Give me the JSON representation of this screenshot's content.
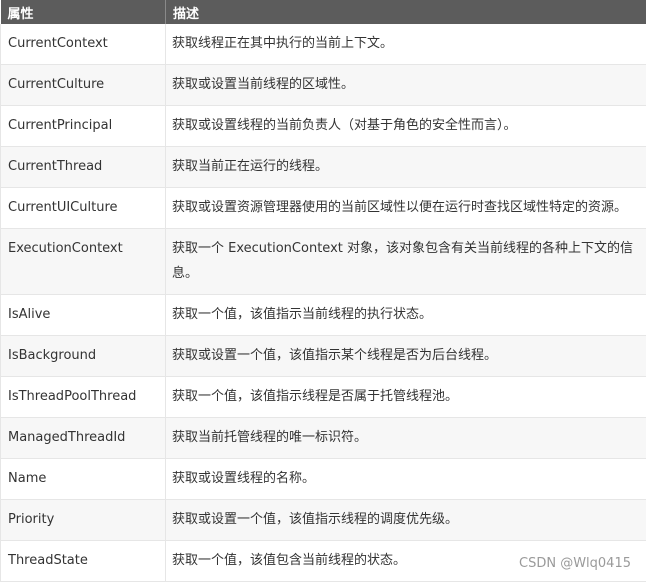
{
  "table": {
    "headers": [
      "属性",
      "描述"
    ],
    "rows": [
      {
        "name": "CurrentContext",
        "desc": "获取线程正在其中执行的当前上下文。"
      },
      {
        "name": "CurrentCulture",
        "desc": "获取或设置当前线程的区域性。"
      },
      {
        "name": "CurrentPrincipal",
        "desc": "获取或设置线程的当前负责人（对基于角色的安全性而言）。"
      },
      {
        "name": "CurrentThread",
        "desc": "获取当前正在运行的线程。"
      },
      {
        "name": "CurrentUICulture",
        "desc": "获取或设置资源管理器使用的当前区域性以便在运行时查找区域性特定的资源。"
      },
      {
        "name": "ExecutionContext",
        "desc": "获取一个 ExecutionContext 对象，该对象包含有关当前线程的各种上下文的信息。"
      },
      {
        "name": "IsAlive",
        "desc": "获取一个值，该值指示当前线程的执行状态。"
      },
      {
        "name": "IsBackground",
        "desc": "获取或设置一个值，该值指示某个线程是否为后台线程。"
      },
      {
        "name": "IsThreadPoolThread",
        "desc": "获取一个值，该值指示线程是否属于托管线程池。"
      },
      {
        "name": "ManagedThreadId",
        "desc": "获取当前托管线程的唯一标识符。"
      },
      {
        "name": "Name",
        "desc": "获取或设置线程的名称。"
      },
      {
        "name": "Priority",
        "desc": "获取或设置一个值，该值指示线程的调度优先级。"
      },
      {
        "name": "ThreadState",
        "desc": "获取一个值，该值包含当前线程的状态。"
      }
    ]
  },
  "watermark": "CSDN @Wlq0415"
}
